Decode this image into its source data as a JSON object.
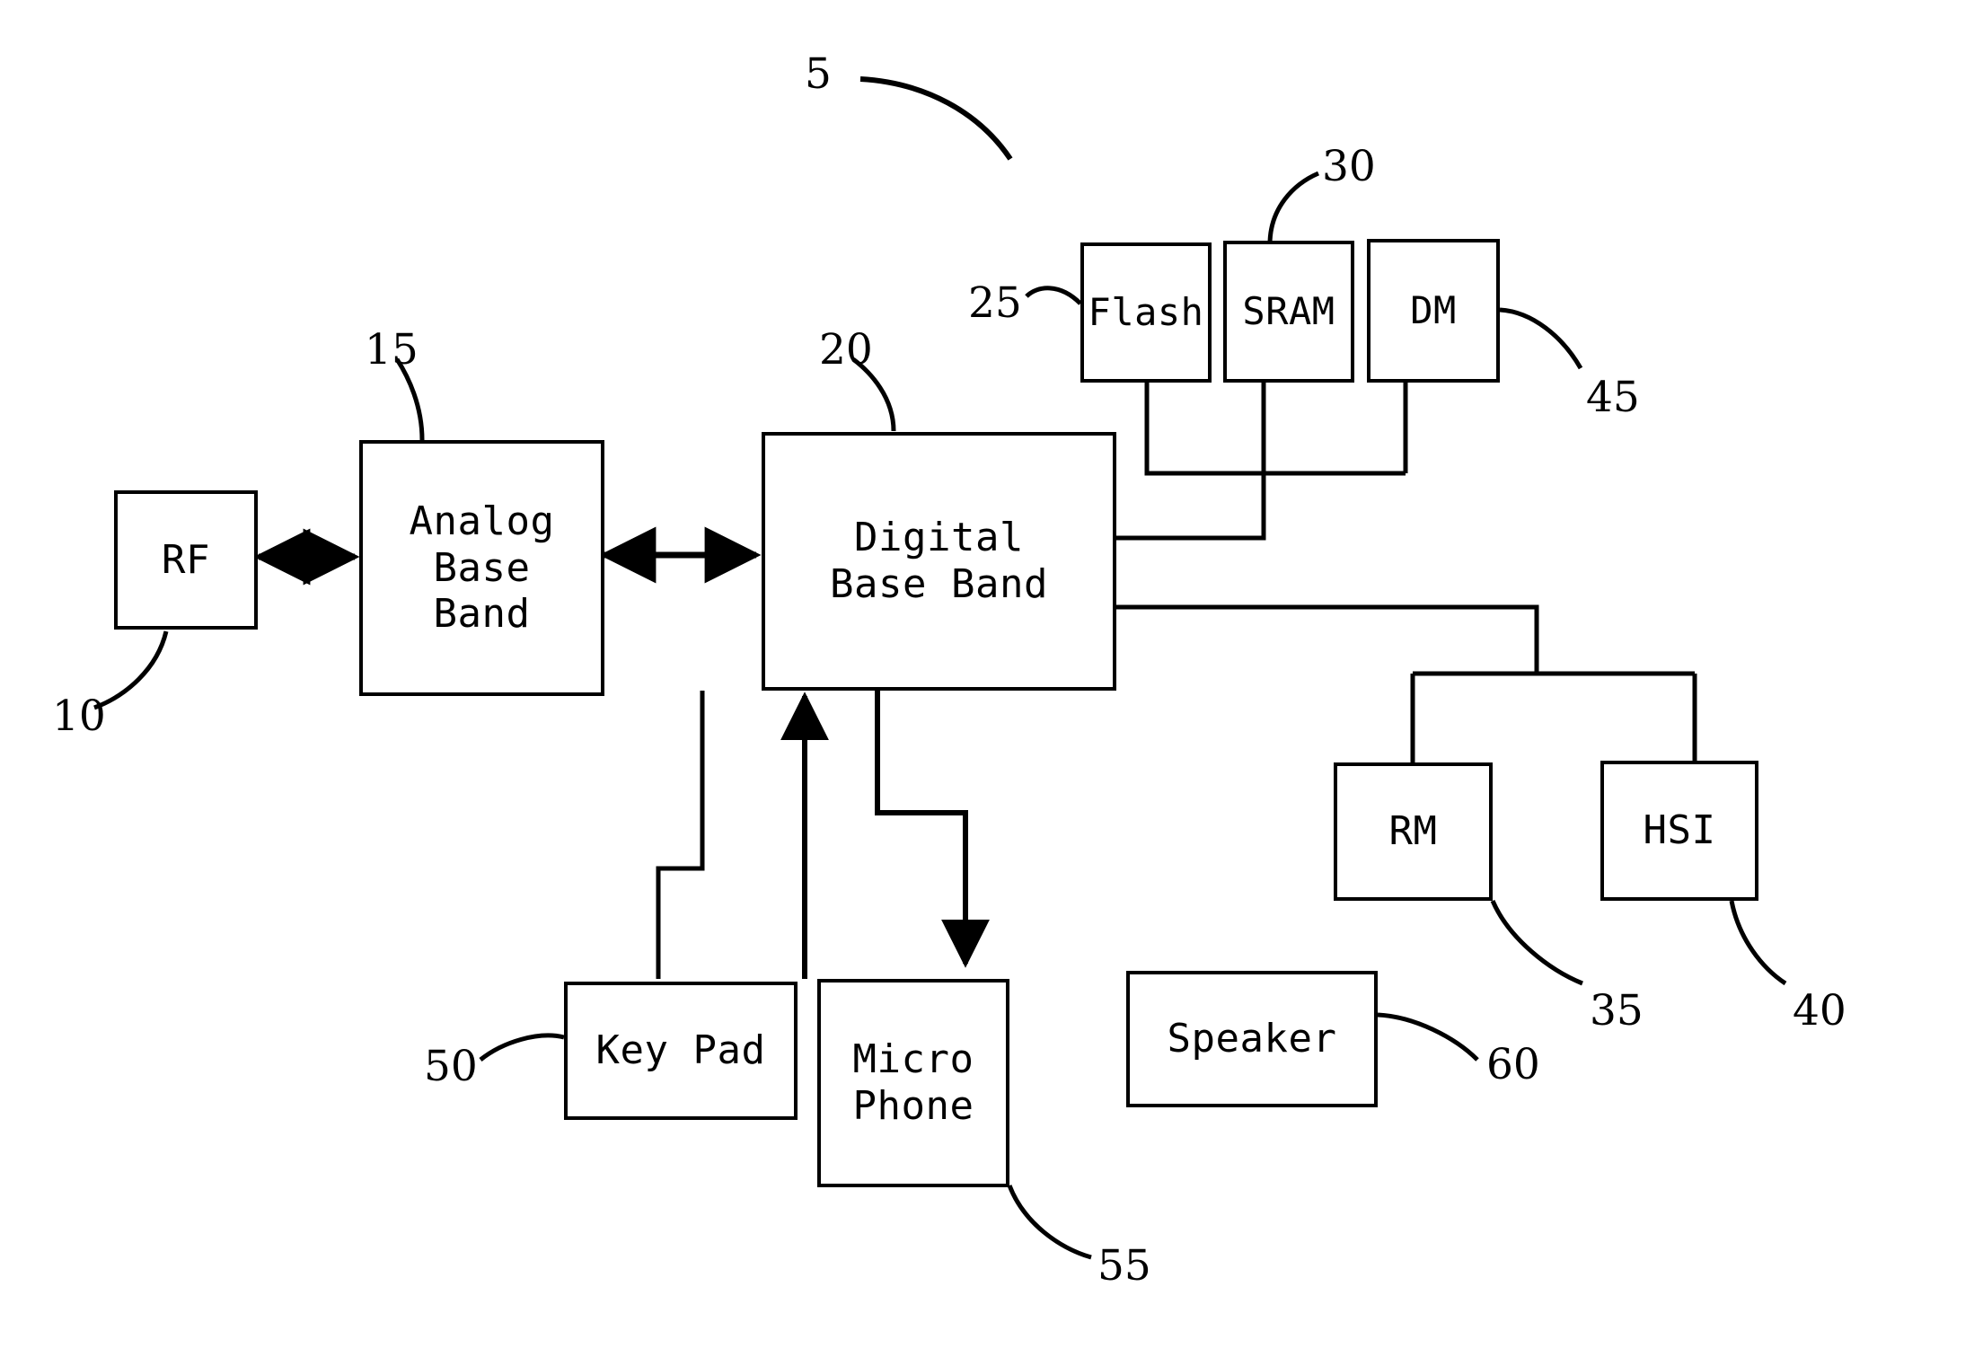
{
  "figure": {
    "type": "patent-block-diagram",
    "overall_reference": "5"
  },
  "blocks": [
    {
      "id": "rf",
      "label": "RF",
      "ref": "10",
      "font_size": 44
    },
    {
      "id": "analog-base-band",
      "label": "Analog\nBase\nBand",
      "ref": "15",
      "font_size": 44
    },
    {
      "id": "digital-base-band",
      "label": "Digital\nBase Band",
      "ref": "20",
      "font_size": 44
    },
    {
      "id": "flash",
      "label": "Flash",
      "ref": "25",
      "font_size": 44
    },
    {
      "id": "sram",
      "label": "SRAM",
      "ref": "30",
      "font_size": 44
    },
    {
      "id": "dm",
      "label": "DM",
      "ref": "45",
      "font_size": 44
    },
    {
      "id": "rm",
      "label": "RM",
      "ref": "35",
      "font_size": 44
    },
    {
      "id": "hsi",
      "label": "HSI",
      "ref": "40",
      "font_size": 44
    },
    {
      "id": "key-pad",
      "label": "Key Pad",
      "ref": "50",
      "font_size": 44
    },
    {
      "id": "micro-phone",
      "label": "Micro\nPhone",
      "ref": "55",
      "font_size": 44
    },
    {
      "id": "speaker",
      "label": "Speaker",
      "ref": "60",
      "font_size": 44
    }
  ],
  "labels": {
    "rf": "RF",
    "analog_base_band": "Analog\nBase\nBand",
    "digital_base_band": "Digital\nBase Band",
    "flash": "Flash",
    "sram": "SRAM",
    "dm": "DM",
    "rm": "RM",
    "hsi": "HSI",
    "key_pad": "Key Pad",
    "micro_phone": "Micro\nPhone",
    "speaker": "Speaker"
  },
  "reference_numerals": {
    "figure": "5",
    "rf": "10",
    "analog_base_band": "15",
    "digital_base_band": "20",
    "flash": "25",
    "sram": "30",
    "rm": "35",
    "hsi": "40",
    "dm": "45",
    "key_pad": "50",
    "micro_phone": "55",
    "speaker": "60"
  },
  "connections": [
    {
      "from": "rf",
      "to": "analog-base-band",
      "style": "double-arrow"
    },
    {
      "from": "analog-base-band",
      "to": "digital-base-band",
      "style": "double-arrow"
    },
    {
      "from": "digital-base-band",
      "to": "flash",
      "style": "line"
    },
    {
      "from": "digital-base-band",
      "to": "sram",
      "style": "line"
    },
    {
      "from": "digital-base-band",
      "to": "dm",
      "style": "line"
    },
    {
      "from": "digital-base-band",
      "to": "rm",
      "style": "line"
    },
    {
      "from": "digital-base-band",
      "to": "hsi",
      "style": "line"
    },
    {
      "from": "digital-base-band",
      "to": "key-pad",
      "style": "line"
    },
    {
      "from": "micro-phone",
      "to": "digital-base-band",
      "style": "arrow-up"
    },
    {
      "from": "digital-base-band",
      "to": "speaker",
      "style": "arrow-down"
    }
  ],
  "colors": {
    "stroke": "#000000",
    "background": "#ffffff"
  }
}
